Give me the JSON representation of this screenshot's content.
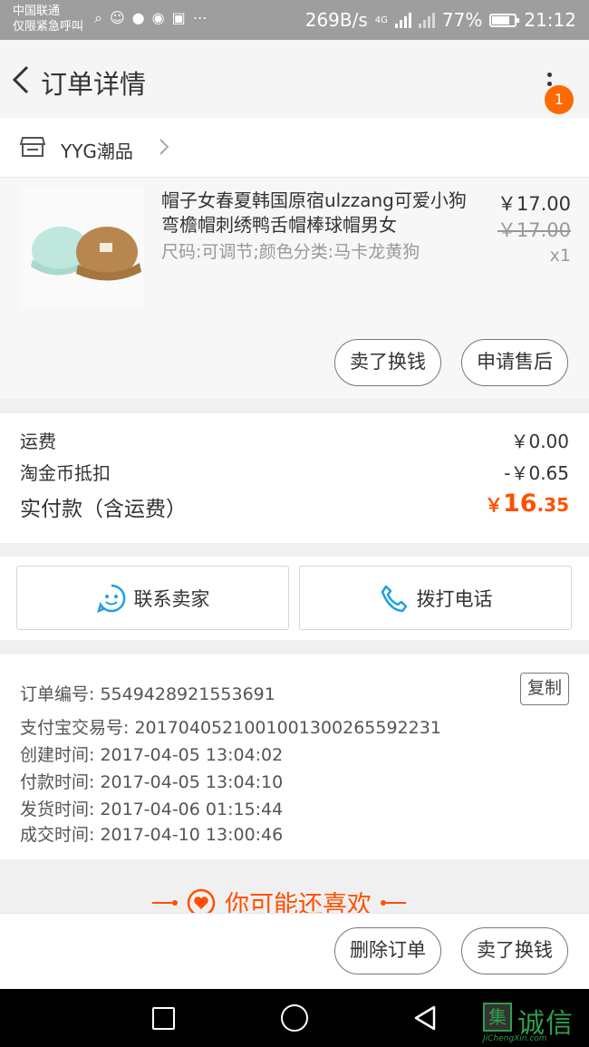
{
  "status_bar": {
    "carrier_line1": "中国联通",
    "carrier_line2": "仅限紧急呼叫",
    "icons": [
      "search-icon",
      "face-icon",
      "avatar-icon",
      "wechat-icon",
      "weibo-icon",
      "more-icon"
    ],
    "net_speed": "269B/s",
    "network": "4G",
    "battery": "77%",
    "battery_level": 0.77,
    "time": "21:12"
  },
  "header": {
    "title": "订单详情",
    "badge_count": "1"
  },
  "shop": {
    "name": "YYG潮品"
  },
  "item": {
    "title": "帽子女春夏韩国原宿ulzzang可爱小狗弯檐帽刺绣鸭舌帽棒球帽男女",
    "spec": "尺码:可调节;颜色分类:马卡龙黄狗",
    "price": "￥17.00",
    "original_price": "￥17.00",
    "quantity": "x1",
    "buttons": [
      "卖了换钱",
      "申请售后"
    ]
  },
  "fees": {
    "shipping_label": "运费",
    "shipping_value": "￥0.00",
    "coin_label": "淘金币抵扣",
    "coin_value": "-￥0.65",
    "total_label": "实付款（含运费）",
    "total_currency": "￥",
    "total_main": "16",
    "total_decimal": ".35"
  },
  "contact": {
    "seller_label": "联系卖家",
    "call_label": "拨打电话"
  },
  "order_info": {
    "order_no": "订单编号: 5549428921553691",
    "copy_label": "复制",
    "alipay_no": "支付宝交易号: 2017040521001001300265592231",
    "created": "创建时间: 2017-04-05 13:04:02",
    "paid": "付款时间: 2017-04-05 13:04:10",
    "shipped": "发货时间: 2017-04-06 01:15:44",
    "completed": "成交时间: 2017-04-10 13:00:46"
  },
  "recommend": {
    "title": "你可能还喜欢"
  },
  "actions": {
    "delete_label": "删除订单",
    "sell_label": "卖了换钱"
  },
  "watermark": {
    "box_char": "集",
    "text": "诚信",
    "sub": "JiChengXin.com"
  },
  "colors": {
    "accent": "#ff5000",
    "badge": "#ff6a00",
    "link_blue": "#1ea0e6"
  }
}
